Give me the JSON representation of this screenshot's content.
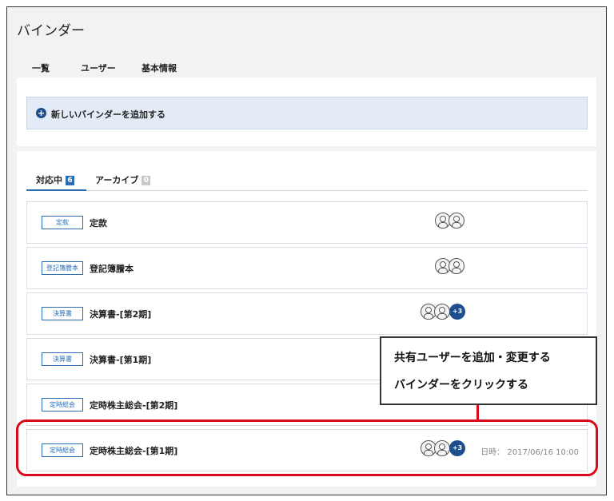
{
  "app": {
    "title": "バインダー"
  },
  "main_tabs": [
    {
      "label": "一覧"
    },
    {
      "label": "ユーザー"
    },
    {
      "label": "基本情報"
    }
  ],
  "add_binder": {
    "label": "新しいバインダーを追加する",
    "icon": "plus-circle-icon"
  },
  "sub_tabs": [
    {
      "label": "対応中",
      "count": "6"
    },
    {
      "label": "アーカイブ",
      "count": "0"
    }
  ],
  "binders": [
    {
      "tag": "定款",
      "title": "定款",
      "avatars": 2,
      "more": "",
      "date": ""
    },
    {
      "tag": "登記簿謄本",
      "title": "登記簿謄本",
      "avatars": 2,
      "more": "",
      "date": ""
    },
    {
      "tag": "決算書",
      "title": "決算書-[第2期]",
      "avatars": 2,
      "more": "+3",
      "date": ""
    },
    {
      "tag": "決算書",
      "title": "決算書-[第1期]",
      "avatars": 0,
      "more": "",
      "date": ""
    },
    {
      "tag": "定時総会",
      "title": "定時株主総会-[第2期]",
      "avatars": 0,
      "more": "",
      "date": ""
    },
    {
      "tag": "定時総会",
      "title": "定時株主総会-[第1期]",
      "avatars": 2,
      "more": "+3",
      "date": "日時： 2017/06/16 10:00"
    }
  ],
  "callout": {
    "line1": "共有ユーザーを追加・変更する",
    "line2": "バインダーをクリックする"
  },
  "colors": {
    "accent": "#2a6db5",
    "dark_blue": "#1f4e8c",
    "highlight_red": "#d7091a",
    "add_box_bg": "#e3ecf6"
  }
}
